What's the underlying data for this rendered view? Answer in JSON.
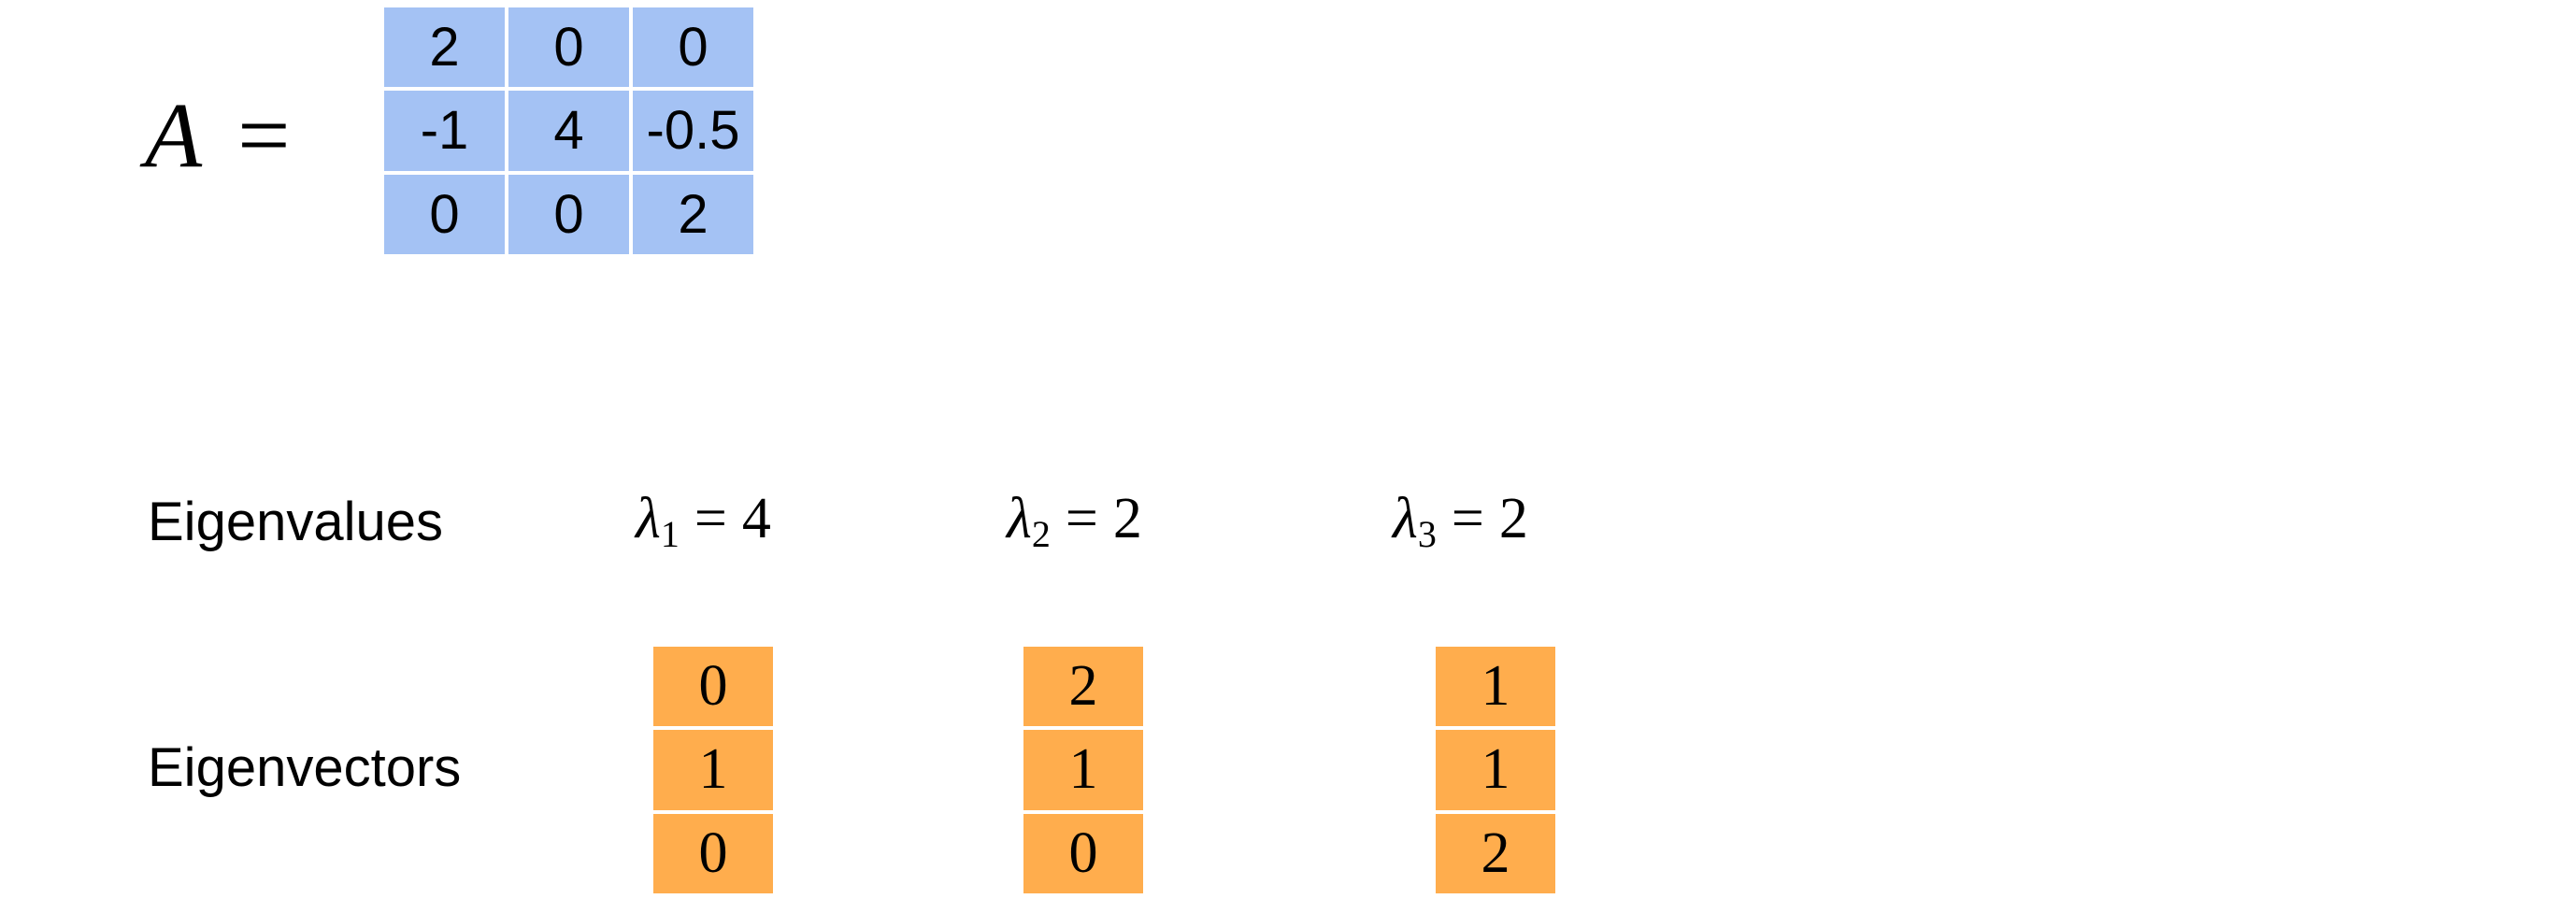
{
  "matrix": {
    "symbol": "A",
    "equals": "=",
    "cell_color": "#a4c2f4",
    "rows": [
      [
        "2",
        "0",
        "0"
      ],
      [
        "-1",
        "4",
        "-0.5"
      ],
      [
        "0",
        "0",
        "2"
      ]
    ]
  },
  "eigenvalues": {
    "label": "Eigenvalues",
    "items": [
      {
        "symbol": "λ",
        "index": "1",
        "equals": "=",
        "value": "4"
      },
      {
        "symbol": "λ",
        "index": "2",
        "equals": "=",
        "value": "2"
      },
      {
        "symbol": "λ",
        "index": "3",
        "equals": "=",
        "value": "2"
      }
    ]
  },
  "eigenvectors": {
    "label": "Eigenvectors",
    "cell_color": "#ffad4d",
    "vectors": [
      [
        "0",
        "1",
        "0"
      ],
      [
        "2",
        "1",
        "0"
      ],
      [
        "1",
        "1",
        "2"
      ]
    ]
  }
}
